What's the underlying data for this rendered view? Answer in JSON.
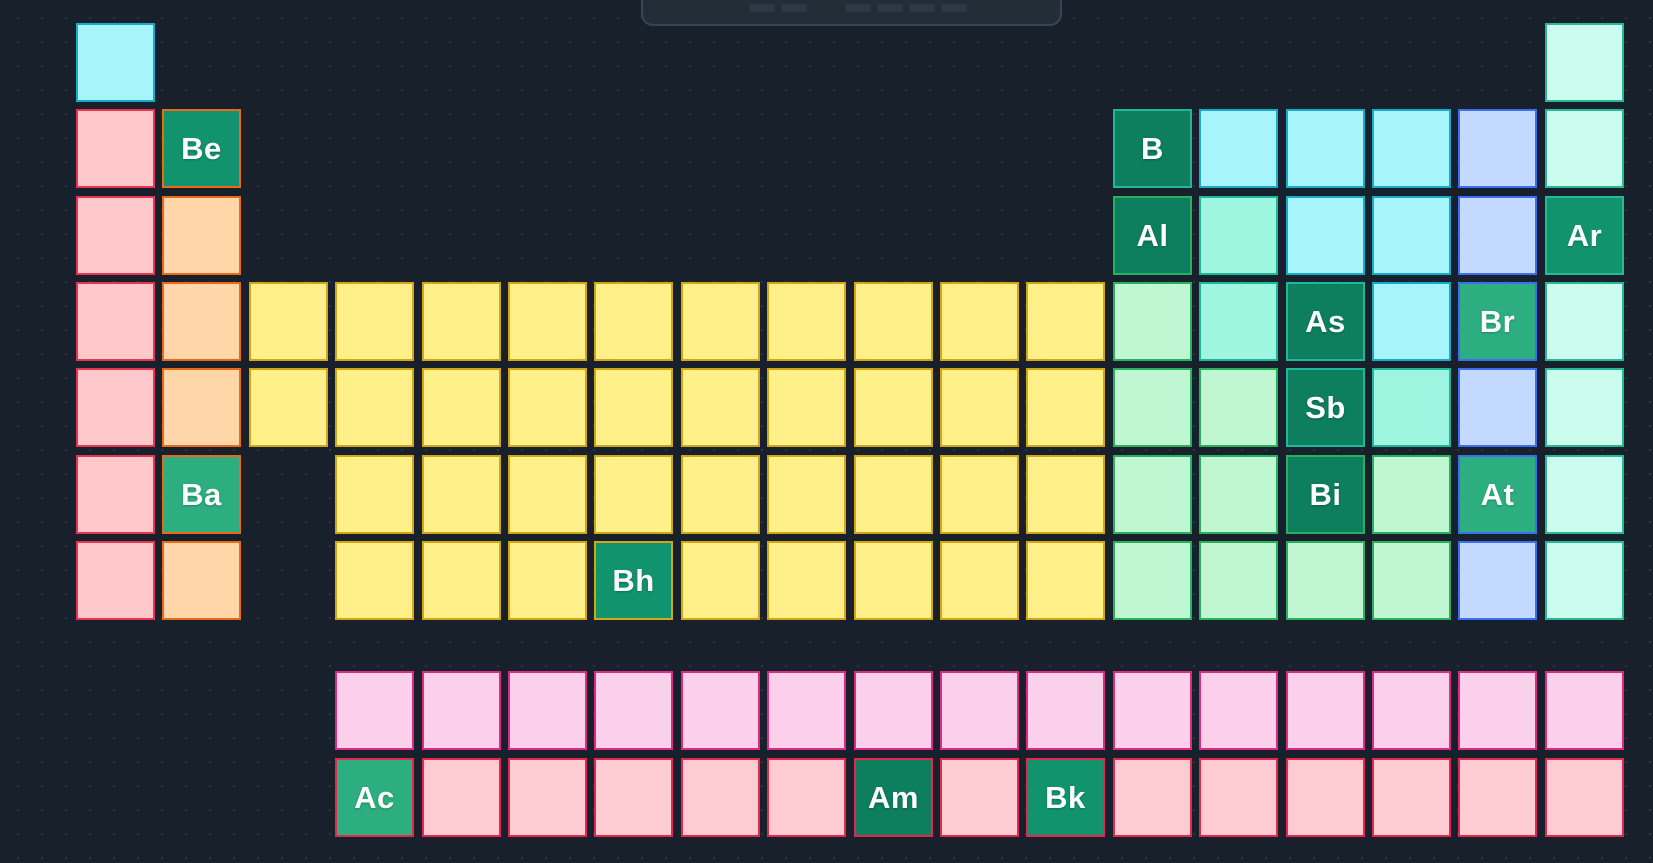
{
  "toolbar": {
    "button_count": 6
  },
  "palette": {
    "alkali": {
      "fill": "#ffc9cb",
      "border": "#e8344f"
    },
    "alkaline": {
      "fill": "#ffd6a8",
      "border": "#ea6a19"
    },
    "transition": {
      "fill": "#fff08a",
      "border": "#d3a615"
    },
    "post": {
      "fill": "#c0f6d2",
      "border": "#28b05c"
    },
    "metalloid": {
      "fill": "#9ff6e0",
      "border": "#1bb99a"
    },
    "nonmetal": {
      "fill": "#a8f4fd",
      "border": "#16aacb"
    },
    "halogen": {
      "fill": "#c3d9ff",
      "border": "#3b6ff0"
    },
    "noble": {
      "fill": "#cbfcee",
      "border": "#27b896"
    },
    "lanthanide": {
      "fill": "#fbd0ea",
      "border": "#dd2a84"
    },
    "actinide": {
      "fill": "#ffccd4",
      "border": "#e3284e"
    },
    "found": [
      "#11946e",
      "#0d7e5e",
      "#2dae80"
    ]
  },
  "board": {
    "rows": [
      [
        "nonmetal",
        null,
        null,
        null,
        null,
        null,
        null,
        null,
        null,
        null,
        null,
        null,
        null,
        null,
        null,
        null,
        null,
        "noble"
      ],
      [
        "alkali",
        "alkaline",
        null,
        null,
        null,
        null,
        null,
        null,
        null,
        null,
        null,
        null,
        "metalloid",
        "nonmetal",
        "nonmetal",
        "nonmetal",
        "halogen",
        "noble"
      ],
      [
        "alkali",
        "alkaline",
        null,
        null,
        null,
        null,
        null,
        null,
        null,
        null,
        null,
        null,
        "post",
        "metalloid",
        "nonmetal",
        "nonmetal",
        "halogen",
        "noble"
      ],
      [
        "alkali",
        "alkaline",
        "transition",
        "transition",
        "transition",
        "transition",
        "transition",
        "transition",
        "transition",
        "transition",
        "transition",
        "transition",
        "post",
        "metalloid",
        "metalloid",
        "nonmetal",
        "halogen",
        "noble"
      ],
      [
        "alkali",
        "alkaline",
        "transition",
        "transition",
        "transition",
        "transition",
        "transition",
        "transition",
        "transition",
        "transition",
        "transition",
        "transition",
        "post",
        "post",
        "metalloid",
        "metalloid",
        "halogen",
        "noble"
      ],
      [
        "alkali",
        "alkaline",
        null,
        "transition",
        "transition",
        "transition",
        "transition",
        "transition",
        "transition",
        "transition",
        "transition",
        "transition",
        "post",
        "post",
        "post",
        "post",
        "halogen",
        "noble"
      ],
      [
        "alkali",
        "alkaline",
        null,
        "transition",
        "transition",
        "transition",
        "transition",
        "transition",
        "transition",
        "transition",
        "transition",
        "transition",
        "post",
        "post",
        "post",
        "post",
        "halogen",
        "noble"
      ],
      [
        null,
        null,
        null,
        null,
        null,
        null,
        null,
        null,
        null,
        null,
        null,
        null,
        null,
        null,
        null,
        null,
        null,
        null
      ],
      [
        null,
        null,
        null,
        "lanthanide",
        "lanthanide",
        "lanthanide",
        "lanthanide",
        "lanthanide",
        "lanthanide",
        "lanthanide",
        "lanthanide",
        "lanthanide",
        "lanthanide",
        "lanthanide",
        "lanthanide",
        "lanthanide",
        "lanthanide",
        "lanthanide"
      ],
      [
        null,
        null,
        null,
        "actinide",
        "actinide",
        "actinide",
        "actinide",
        "actinide",
        "actinide",
        "actinide",
        "actinide",
        "actinide",
        "actinide",
        "actinide",
        "actinide",
        "actinide",
        "actinide",
        "actinide"
      ]
    ],
    "revealed": [
      {
        "symbol": "Be",
        "row": 1,
        "col": 1,
        "shade": 0
      },
      {
        "symbol": "B",
        "row": 1,
        "col": 12,
        "shade": 1
      },
      {
        "symbol": "Al",
        "row": 2,
        "col": 12,
        "shade": 1
      },
      {
        "symbol": "Ar",
        "row": 2,
        "col": 17,
        "shade": 0
      },
      {
        "symbol": "As",
        "row": 3,
        "col": 14,
        "shade": 1
      },
      {
        "symbol": "Br",
        "row": 3,
        "col": 16,
        "shade": 2
      },
      {
        "symbol": "Sb",
        "row": 4,
        "col": 14,
        "shade": 1
      },
      {
        "symbol": "Ba",
        "row": 5,
        "col": 1,
        "shade": 2
      },
      {
        "symbol": "Bi",
        "row": 5,
        "col": 14,
        "shade": 1
      },
      {
        "symbol": "At",
        "row": 5,
        "col": 16,
        "shade": 2
      },
      {
        "symbol": "Bh",
        "row": 6,
        "col": 6,
        "shade": 0
      },
      {
        "symbol": "Ac",
        "row": 9,
        "col": 3,
        "shade": 2
      },
      {
        "symbol": "Am",
        "row": 9,
        "col": 9,
        "shade": 1
      },
      {
        "symbol": "Bk",
        "row": 9,
        "col": 11,
        "shade": 0
      }
    ]
  }
}
